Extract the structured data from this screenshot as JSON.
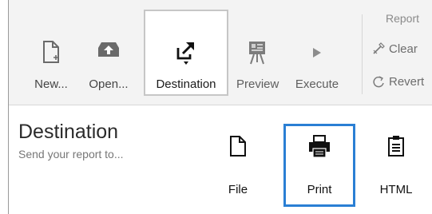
{
  "ribbon": {
    "buttons": [
      {
        "label": "New...",
        "icon": "new-document-icon"
      },
      {
        "label": "Open...",
        "icon": "open-icon"
      },
      {
        "label": "Destination",
        "icon": "destination-icon",
        "selected": true
      },
      {
        "label": "Preview",
        "icon": "preview-icon"
      },
      {
        "label": "Execute",
        "icon": "play-icon"
      }
    ],
    "report_group": {
      "title": "Report",
      "clear_label": "Clear",
      "revert_label": "Revert"
    }
  },
  "destination": {
    "title": "Destination",
    "subtitle": "Send your report to...",
    "options": [
      {
        "label": "File",
        "icon": "file-icon"
      },
      {
        "label": "Print",
        "icon": "printer-icon",
        "selected": true
      },
      {
        "label": "HTML",
        "icon": "html-icon"
      }
    ]
  },
  "colors": {
    "selection_border": "#2a7fd4",
    "ribbon_background": "#f3f3f3"
  }
}
